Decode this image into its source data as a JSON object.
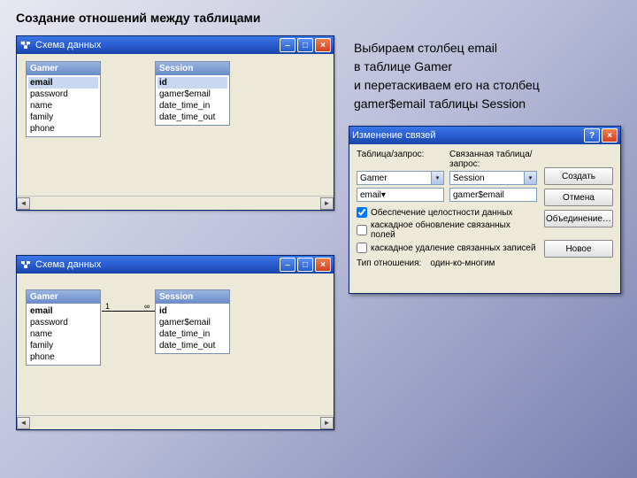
{
  "pageTitle": "Создание отношений между таблицами",
  "instructions": [
    "Выбираем столбец email",
    "в таблице Gamer",
    "и перетаскиваем его на столбец",
    "gamer$email таблицы Session"
  ],
  "schemaWindow": {
    "title": "Схема данных"
  },
  "tables": {
    "gamer": {
      "name": "Gamer",
      "fields": [
        "email",
        "password",
        "name",
        "family",
        "phone"
      ]
    },
    "session": {
      "name": "Session",
      "fields": [
        "id",
        "gamer$email",
        "date_time_in",
        "date_time_out"
      ]
    }
  },
  "relation": {
    "leftCard": "1",
    "rightCard": "∞"
  },
  "dialog": {
    "title": "Изменение связей",
    "labels": {
      "left": "Таблица/запрос:",
      "right": "Связанная таблица/запрос:"
    },
    "leftTable": "Gamer",
    "rightTable": "Session",
    "mapLeft": "email",
    "mapRight": "gamer$email",
    "checks": {
      "integrity": "Обеспечение целостности данных",
      "cascadeUpdate": "каскадное обновление связанных полей",
      "cascadeDelete": "каскадное удаление связанных записей"
    },
    "typeLabel": "Тип отношения:",
    "typeValue": "один-ко-многим",
    "buttons": {
      "create": "Создать",
      "cancel": "Отмена",
      "join": "Объединение…",
      "new": "Новое"
    }
  },
  "icons": {
    "minimize": "–",
    "maximize": "□",
    "close": "×",
    "help": "?",
    "chevronDown": "▾",
    "arrowLeft": "◄",
    "arrowRight": "►"
  }
}
